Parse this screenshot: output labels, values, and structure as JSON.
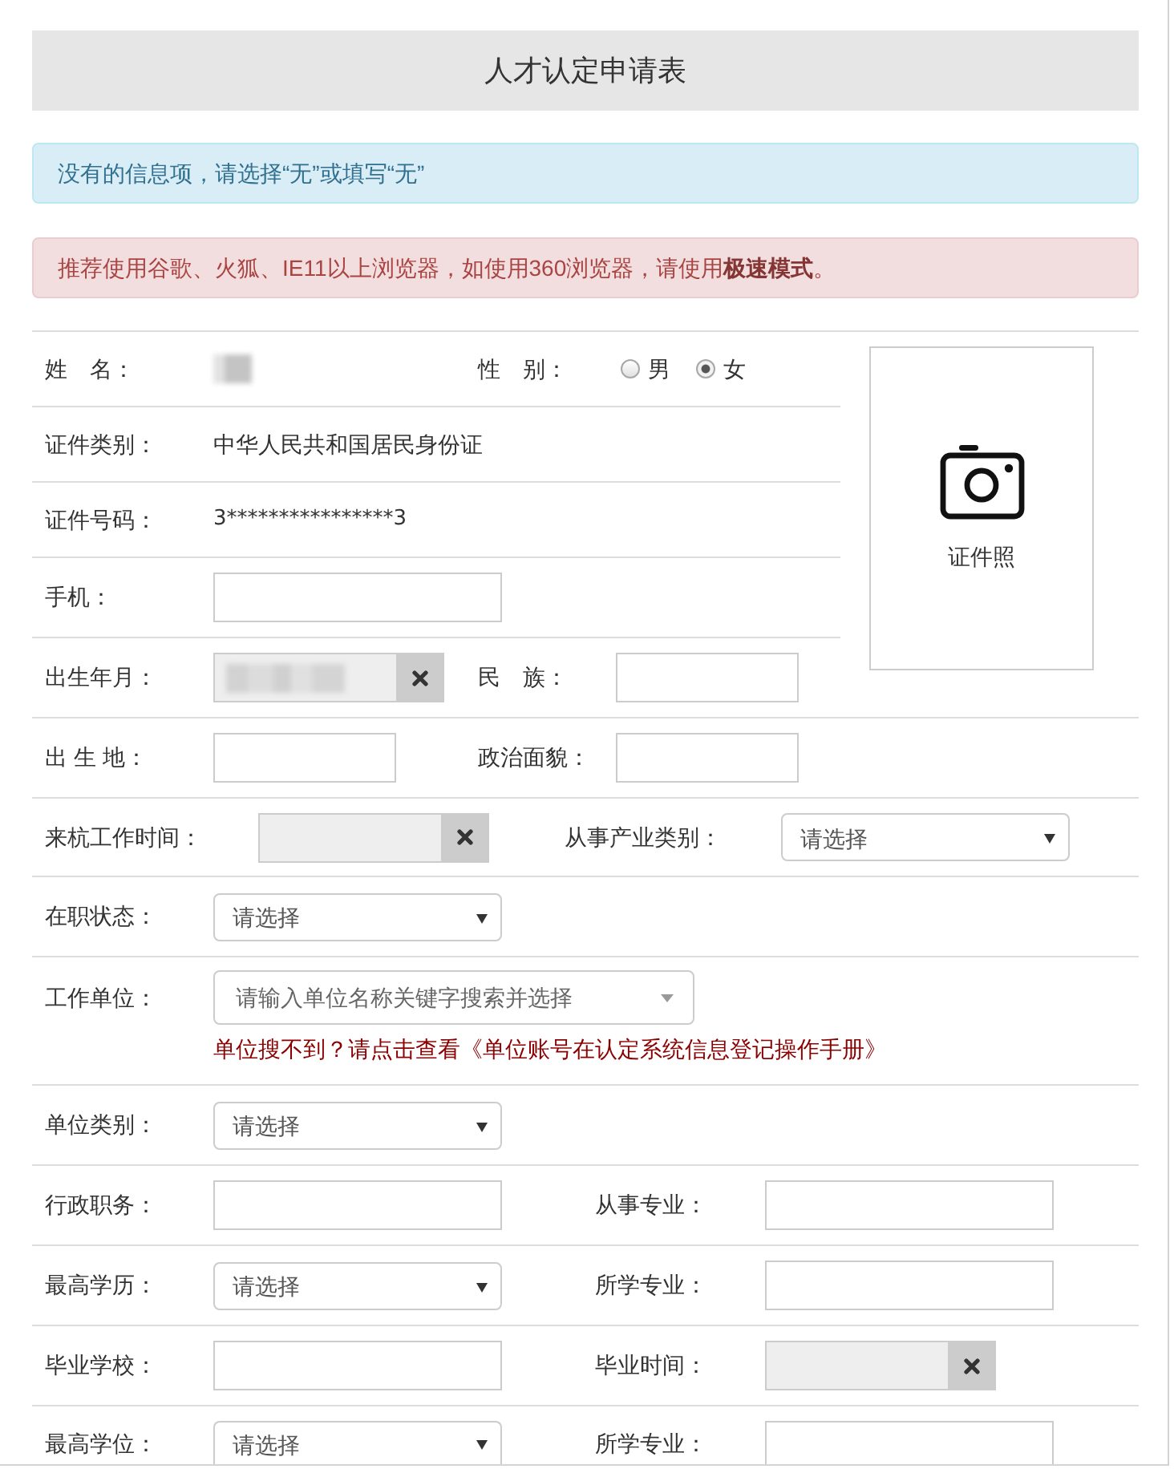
{
  "title": "人才认定申请表",
  "alerts": [
    {
      "kind": "info",
      "text": "没有的信息项，请选择“无”或填写“无”"
    },
    {
      "kind": "danger",
      "text": "推荐使用谷歌、火狐、IE11以上浏览器，如使用360浏览器，请使用**极速模式**。"
    }
  ],
  "top_section": {
    "rows": [
      {
        "fields": [
          {
            "kind": "static",
            "label": "姓　名：",
            "redacted": true
          },
          {
            "kind": "radio",
            "label": "性　别：",
            "options": [
              {
                "label": "男",
                "selected": false
              },
              {
                "label": "女",
                "selected": true
              }
            ]
          }
        ]
      },
      {
        "fields": [
          {
            "kind": "static",
            "label": "证件类别：",
            "value": "中华人民共和国居民身份证",
            "redacted": false
          }
        ]
      },
      {
        "fields": [
          {
            "kind": "masked",
            "label": "证件号码：",
            "value": "3****************3"
          }
        ]
      },
      {
        "fields": [
          {
            "kind": "input",
            "label": "手机："
          }
        ]
      },
      {
        "fields": [
          {
            "kind": "date",
            "label": "出生年月：",
            "redacted": true
          },
          {
            "kind": "input",
            "label": "民　族："
          }
        ]
      }
    ],
    "photo": {
      "label": "证件照"
    }
  },
  "rows": [
    {
      "fields": [
        {
          "kind": "input",
          "label": "出 生 地："
        },
        {
          "kind": "input",
          "label": "政治面貌："
        }
      ]
    },
    {
      "fields": [
        {
          "kind": "date",
          "label": "来杭工作时间：",
          "redacted": false
        },
        {
          "kind": "select",
          "label": "从事产业类别：",
          "placeholder": "请选择"
        }
      ]
    },
    {
      "fields": [
        {
          "kind": "select",
          "label": "在职状态：",
          "placeholder": "请选择"
        }
      ]
    },
    {
      "fields": [
        {
          "kind": "search",
          "label": "工作单位：",
          "placeholder": "请输入单位名称关键字搜索并选择",
          "link": "单位搜不到？请点击查看《单位账号在认定系统信息登记操作手册》"
        }
      ]
    },
    {
      "fields": [
        {
          "kind": "select",
          "label": "单位类别：",
          "placeholder": "请选择"
        }
      ]
    },
    {
      "fields": [
        {
          "kind": "input",
          "label": "行政职务："
        },
        {
          "kind": "input",
          "label": "从事专业："
        }
      ]
    },
    {
      "fields": [
        {
          "kind": "select",
          "label": "最高学历：",
          "placeholder": "请选择"
        },
        {
          "kind": "input",
          "label": "所学专业："
        }
      ]
    },
    {
      "fields": [
        {
          "kind": "input",
          "label": "毕业学校："
        },
        {
          "kind": "date",
          "label": "毕业时间：",
          "redacted": false
        }
      ]
    },
    {
      "fields": [
        {
          "kind": "select",
          "label": "最高学位：",
          "placeholder": "请选择"
        },
        {
          "kind": "input",
          "label": "所学专业："
        }
      ]
    }
  ]
}
